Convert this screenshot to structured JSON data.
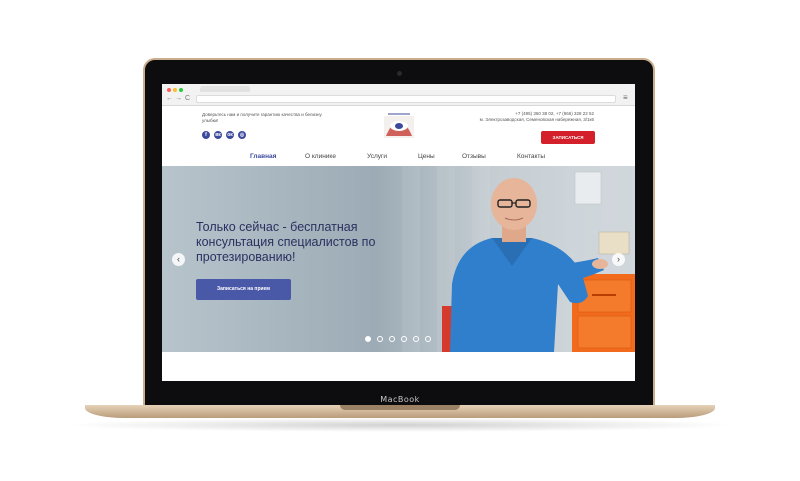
{
  "device": {
    "brand": "MacBook"
  },
  "browser": {
    "back_icon": "←",
    "forward_icon": "→",
    "reload_icon": "C",
    "menu_icon": "≡"
  },
  "header": {
    "tagline": "Доверьтесь нам и получите гарантию качества и белизну улыбки!",
    "phones": "+7 (495) 360 38 02, +7 (966) 328 22 52",
    "address": "м. Электрозаводская, Семеновская набережная, 3/1к6",
    "signup_button": "ЗАПИСАТЬСЯ",
    "social": [
      {
        "icon": "facebook-icon",
        "glyph": "f"
      },
      {
        "icon": "vk-icon",
        "glyph": "вк"
      },
      {
        "icon": "odnoklassniki-icon",
        "glyph": "ок"
      },
      {
        "icon": "instagram-icon",
        "glyph": "◎"
      }
    ]
  },
  "nav": {
    "items": [
      {
        "label": "Главная",
        "active": true
      },
      {
        "label": "О клинике",
        "active": false
      },
      {
        "label": "Услуги",
        "active": false
      },
      {
        "label": "Цены",
        "active": false
      },
      {
        "label": "Отзывы",
        "active": false
      },
      {
        "label": "Контакты",
        "active": false
      }
    ]
  },
  "hero": {
    "title": "Только сейчас - бесплатная консультация специалистов по протезированию!",
    "button": "Записаться на прием",
    "prev_icon": "‹",
    "next_icon": "›",
    "slides_count": 6,
    "active_slide": 1
  },
  "colors": {
    "brand_blue": "#3d4a9c",
    "cta_red": "#d4202a",
    "laptop_gold": "#c9ad8c"
  }
}
